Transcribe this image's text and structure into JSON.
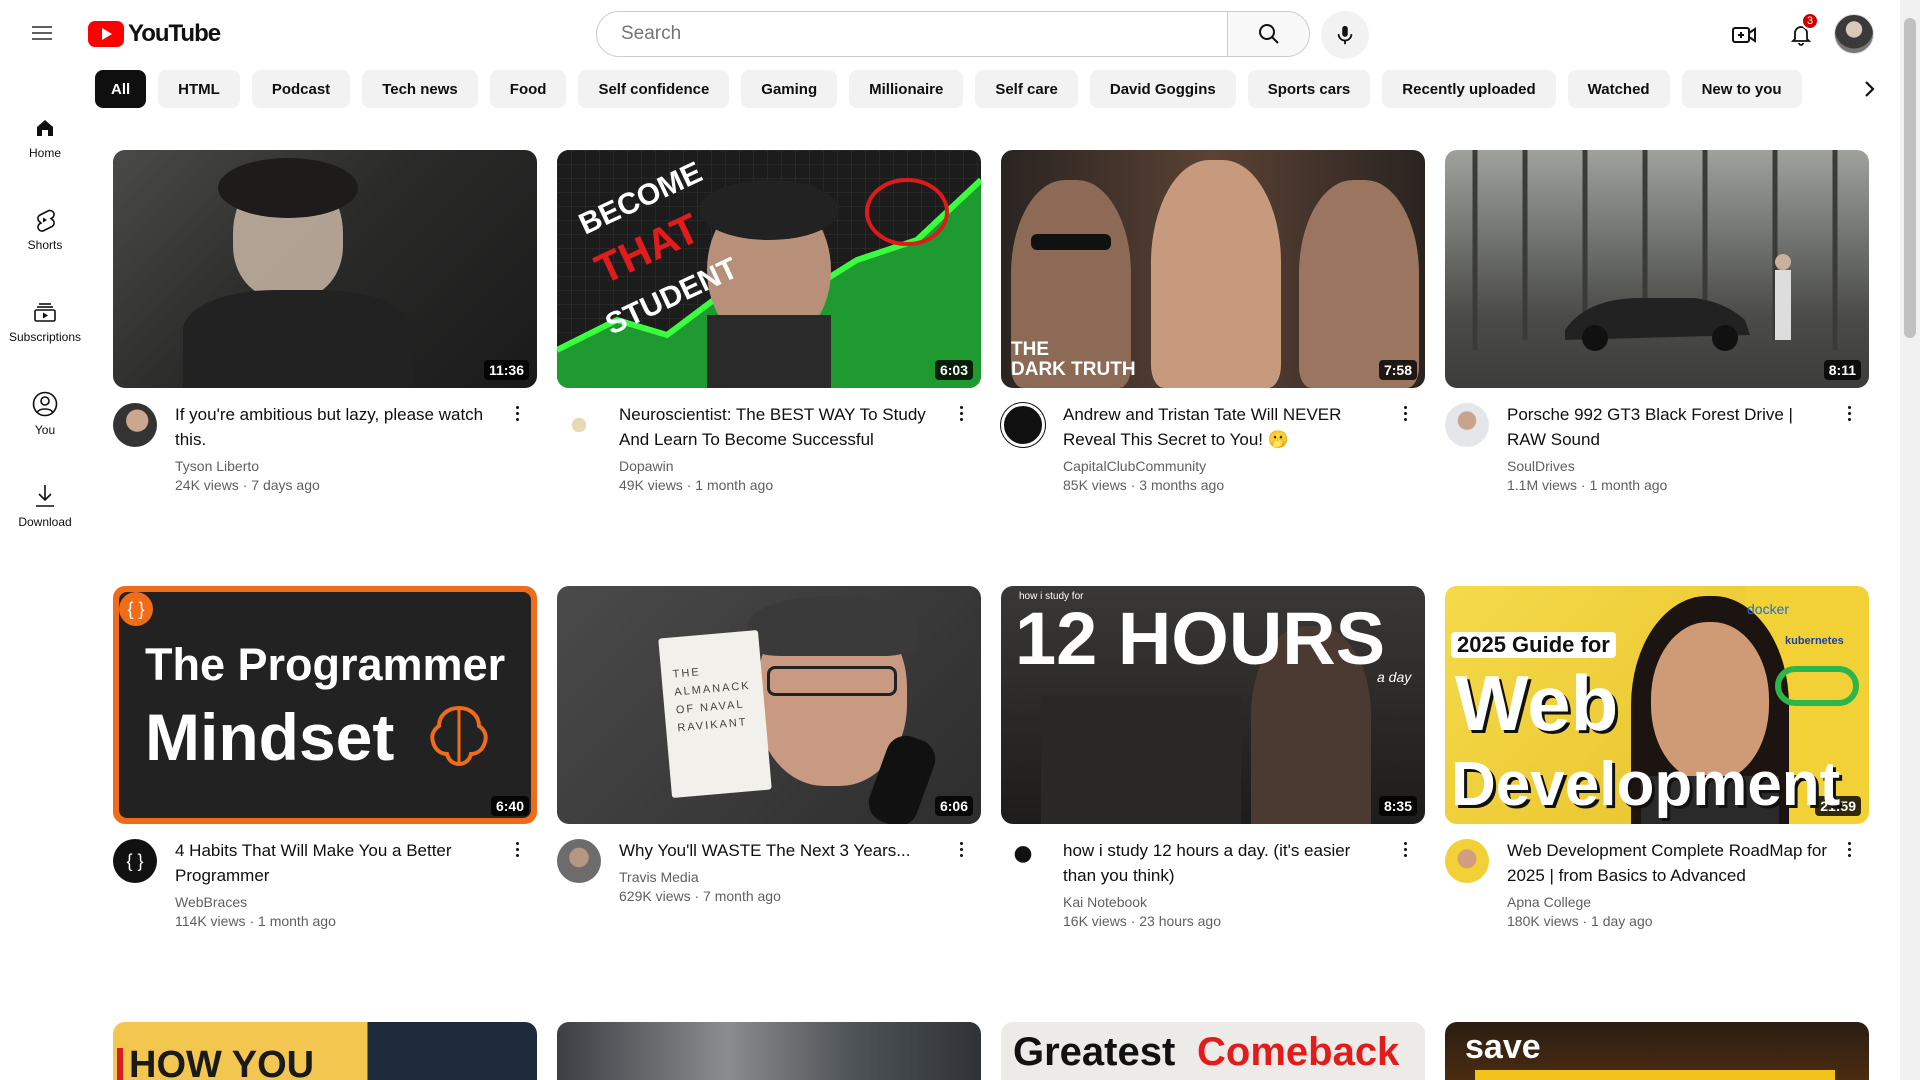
{
  "app": {
    "logo_text": "YouTube",
    "brand_color": "#ff0000"
  },
  "search": {
    "placeholder": "Search",
    "value": ""
  },
  "notifications": {
    "count": "3"
  },
  "chips": [
    "All",
    "HTML",
    "Podcast",
    "Tech news",
    "Food",
    "Self confidence",
    "Gaming",
    "Millionaire",
    "Self care",
    "David Goggins",
    "Sports cars",
    "Recently uploaded",
    "Watched",
    "New to you"
  ],
  "sidebar": {
    "items": [
      {
        "label": "Home",
        "icon": "home-icon"
      },
      {
        "label": "Shorts",
        "icon": "shorts-icon"
      },
      {
        "label": "Subscriptions",
        "icon": "subscriptions-icon"
      },
      {
        "label": "You",
        "icon": "you-icon"
      },
      {
        "label": "Download",
        "icon": "download-icon"
      }
    ]
  },
  "videos": [
    {
      "title": "If you're ambitious but lazy, please watch this.",
      "channel": "Tyson Liberto",
      "views": "24K views",
      "age": "7 days ago",
      "duration": "11:36"
    },
    {
      "title": "Neuroscientist: The BEST WAY To Study And Learn To Become Successful",
      "channel": "Dopawin",
      "views": "49K views",
      "age": "1 month ago",
      "duration": "6:03",
      "thumb_text": [
        "BECOME",
        "THAT",
        "STUDENT"
      ]
    },
    {
      "title": "Andrew and Tristan Tate Will NEVER Reveal This Secret to You! 🫢",
      "channel": "CapitalClubCommunity",
      "views": "85K views",
      "age": "3 months ago",
      "duration": "7:58",
      "thumb_text": [
        "THE",
        "DARK TRUTH"
      ]
    },
    {
      "title": "Porsche 992 GT3 Black Forest Drive | RAW Sound",
      "channel": "SoulDrives",
      "views": "1.1M views",
      "age": "1 month ago",
      "duration": "8:11"
    },
    {
      "title": "4 Habits That Will Make You a Better Programmer",
      "channel": "WebBraces",
      "views": "114K views",
      "age": "1 month ago",
      "duration": "6:40",
      "thumb_text": [
        "The Programmer",
        "Mindset"
      ]
    },
    {
      "title": "Why You'll WASTE The Next 3 Years...",
      "channel": "Travis Media",
      "views": "629K views",
      "age": "7 month ago",
      "duration": "6:06",
      "thumb_text": [
        "THE ALMANACK OF NAVAL RAVIKANT"
      ]
    },
    {
      "title": "how i study 12 hours a day. (it's easier than you think)",
      "channel": "Kai Notebook",
      "views": "16K views",
      "age": "23 hours ago",
      "duration": "8:35",
      "thumb_text": [
        "how i study for",
        "12 HOURS",
        "a day"
      ]
    },
    {
      "title": "Web Development Complete RoadMap for 2025 | from Basics to Advanced",
      "channel": "Apna College",
      "views": "180K views",
      "age": "1 day ago",
      "duration": "21:59",
      "thumb_text": [
        "2025 Guide for",
        "Web",
        "Development",
        "docker",
        "kubernetes"
      ]
    },
    {
      "title": "",
      "thumb_text": [
        "HOW YOU"
      ]
    },
    {
      "title": ""
    },
    {
      "title": "",
      "thumb_text": [
        "Greatest",
        "Comeback"
      ]
    },
    {
      "title": "",
      "thumb_text": [
        "save"
      ]
    }
  ]
}
